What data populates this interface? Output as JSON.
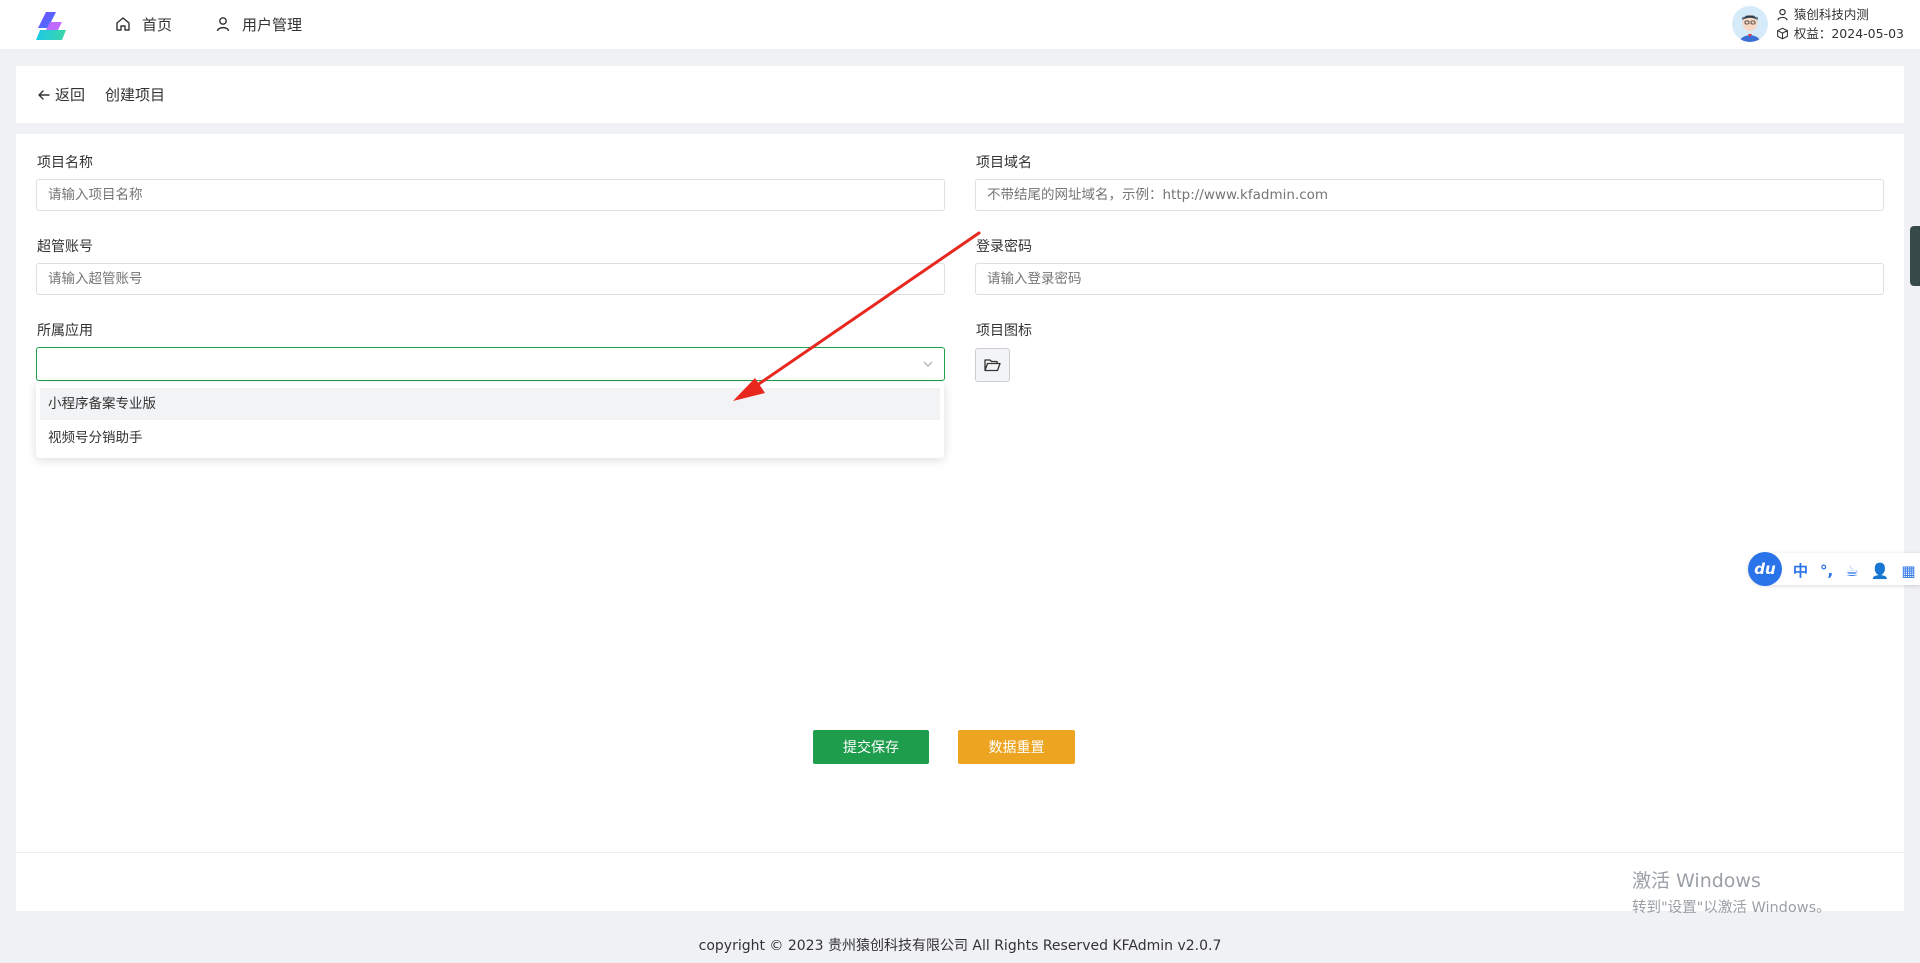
{
  "nav": {
    "home": "首页",
    "users": "用户管理"
  },
  "user": {
    "name": "猿创科技内测",
    "rights": "权益：2024-05-03"
  },
  "breadcrumb": {
    "back": "返回",
    "title": "创建项目"
  },
  "form": {
    "project_name": {
      "label": "项目名称",
      "placeholder": "请输入项目名称"
    },
    "project_domain": {
      "label": "项目域名",
      "placeholder": "不带结尾的网址域名，示例：http://www.kfadmin.com"
    },
    "admin_account": {
      "label": "超管账号",
      "placeholder": "请输入超管账号"
    },
    "login_password": {
      "label": "登录密码",
      "placeholder": "请输入登录密码"
    },
    "app": {
      "label": "所属应用",
      "value": ""
    },
    "project_icon": {
      "label": "项目图标"
    }
  },
  "dropdown": {
    "options": [
      "小程序备案专业版",
      "视频号分销助手"
    ]
  },
  "buttons": {
    "save": "提交保存",
    "reset": "数据重置"
  },
  "watermark": {
    "line1": "激活 Windows",
    "line2": "转到\"设置\"以激活 Windows。"
  },
  "copyright": "copyright © 2023    贵州猿创科技有限公司 All Rights Reserved    KFAdmin v2.0.7",
  "ime": {
    "logo": "du",
    "items": [
      "中",
      "°,",
      "☕",
      "👤",
      "▦"
    ]
  },
  "colors": {
    "primary": "#1e9e4d",
    "warning": "#eca421",
    "annotation_arrow": "#e8281f"
  }
}
